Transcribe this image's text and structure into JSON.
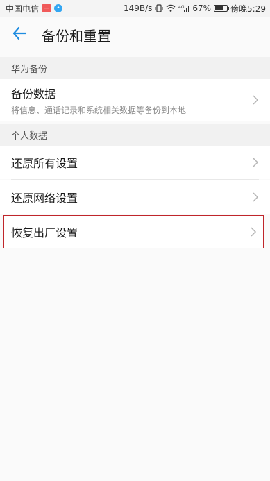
{
  "status_bar": {
    "carrier": "中国电信",
    "speed": "149B/s",
    "signal_label": "4G",
    "battery_percent": "67%",
    "time": "傍晚5:29",
    "battery_level": 0.67
  },
  "header": {
    "title": "备份和重置",
    "back_icon": "arrow-left-icon"
  },
  "sections": {
    "huawei_backup": {
      "header": "华为备份",
      "items": [
        {
          "label": "备份数据",
          "description": "将信息、通话记录和系统相关数据等备份到本地"
        }
      ]
    },
    "personal_data": {
      "header": "个人数据",
      "items": [
        {
          "label": "还原所有设置"
        },
        {
          "label": "还原网络设置"
        },
        {
          "label": "恢复出厂设置"
        }
      ]
    }
  },
  "colors": {
    "accent": "#1f8ce0",
    "highlight_border": "#c0262b",
    "background": "#fafafa"
  }
}
